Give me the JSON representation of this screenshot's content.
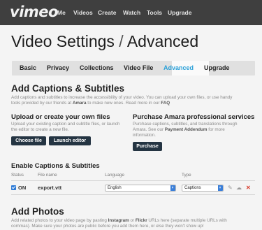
{
  "topbar": {
    "logo": "vimeo",
    "nav": [
      "Me",
      "Videos",
      "Create",
      "Watch",
      "Tools",
      "Upgrade"
    ]
  },
  "page": {
    "title_main": "Video Settings",
    "title_sep": " / ",
    "title_sub": "Advanced"
  },
  "tabs": [
    "Basic",
    "Privacy",
    "Collections",
    "Video File",
    "Advanced",
    "Upgrade"
  ],
  "active_tab": "Advanced",
  "captions": {
    "heading": "Add Captions & Subtitles",
    "desc_line1": "Add captions and subtitles to increase the accessibility of your video. You can upload your own files, or use handy",
    "desc_line2_pre": "tools provided by our friends at ",
    "desc_line2_link": "Amara",
    "desc_line2_mid": " to make new ones. Read more in our ",
    "desc_line2_faq": "FAQ",
    "upload": {
      "heading": "Upload or create your own files",
      "desc_line1": "Upload your existing caption and subtitle files, or launch",
      "desc_line2": "the editor to create a new file.",
      "choose_label": "Choose file",
      "launch_label": "Launch editor"
    },
    "purchase": {
      "heading": "Purchase Amara professional services",
      "desc_line1": "Purchase captions, subtitles, and translations through",
      "desc_line2_pre": "Amara. See our ",
      "desc_line2_link": "Payment Addendum",
      "desc_line2_post": " for more",
      "desc_line3": "information.",
      "purchase_label": "Purchase"
    }
  },
  "enable": {
    "heading": "Enable Captions & Subtitles",
    "columns": [
      "Status",
      "File name",
      "Language",
      "Type"
    ],
    "rows": [
      {
        "status": "ON",
        "file": "export.vtt",
        "language": "English",
        "type": "Captions"
      }
    ]
  },
  "photos": {
    "heading": "Add Photos",
    "desc_line1_pre": "Add related photos to your video page by pasting ",
    "desc_line1_b1": "Instagram",
    "desc_line1_mid": " or ",
    "desc_line1_b2": "Flickr",
    "desc_line1_post": " URLs here (separate multiple URLs with",
    "desc_line2": "commas). Make sure your photos are public before you add them here, or else they won't show up!"
  },
  "colors": {
    "topbar": "#3f3f3f",
    "accent": "#2aa0d8",
    "button": "#243442",
    "delete": "#d83a2a"
  },
  "icons": [
    "pencil-icon",
    "cloud-icon",
    "delete-icon",
    "checkbox-icon",
    "chevron-down-icon"
  ]
}
